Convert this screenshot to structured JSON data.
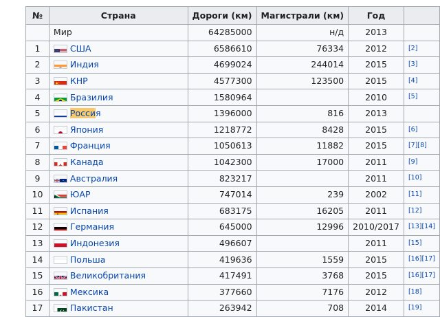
{
  "headers": {
    "rank": "№",
    "country": "Страна",
    "roads": "Дороги (км)",
    "highways": "Магистрали (км)",
    "year": "Год",
    "ref": ""
  },
  "world": {
    "name": "Мир",
    "roads": "64285000",
    "highways": "н/д",
    "year": "2013"
  },
  "rows": [
    {
      "rank": "1",
      "flag": "flag-usa-icon",
      "name": "США",
      "roads": "6586610",
      "highways": "76334",
      "year": "2012",
      "ref": "[2]"
    },
    {
      "rank": "2",
      "flag": "flag-india-icon",
      "name": "Индия",
      "roads": "4699024",
      "highways": "244014",
      "year": "2015",
      "ref": "[3]"
    },
    {
      "rank": "3",
      "flag": "flag-china-icon",
      "name": "КНР",
      "roads": "4577300",
      "highways": "123500",
      "year": "2015",
      "ref": "[4]"
    },
    {
      "rank": "4",
      "flag": "flag-brazil-icon",
      "name": "Бразилия",
      "roads": "1580964",
      "highways": "",
      "year": "2010",
      "ref": "[5]"
    },
    {
      "rank": "5",
      "flag": "flag-russia-icon",
      "name_hl": "Росси",
      "name_rest": "я",
      "roads": "1396000",
      "highways": "816",
      "year": "2013",
      "ref": ""
    },
    {
      "rank": "6",
      "flag": "flag-japan-icon",
      "name": "Япония",
      "roads": "1218772",
      "highways": "8428",
      "year": "2015",
      "ref": "[6]"
    },
    {
      "rank": "7",
      "flag": "flag-france-icon",
      "name": "Франция",
      "roads": "1050613",
      "highways": "11882",
      "year": "2015",
      "ref": "[7][8]"
    },
    {
      "rank": "8",
      "flag": "flag-canada-icon",
      "name": "Канада",
      "roads": "1042300",
      "highways": "17000",
      "year": "2011",
      "ref": "[9]"
    },
    {
      "rank": "9",
      "flag": "flag-australia-icon",
      "name": "Австралия",
      "roads": "823217",
      "highways": "",
      "year": "2011",
      "ref": "[10]"
    },
    {
      "rank": "10",
      "flag": "flag-sa-icon",
      "name": "ЮАР",
      "roads": "747014",
      "highways": "239",
      "year": "2002",
      "ref": "[11]"
    },
    {
      "rank": "11",
      "flag": "flag-spain-icon",
      "name": "Испания",
      "roads": "683175",
      "highways": "16205",
      "year": "2011",
      "ref": "[12]"
    },
    {
      "rank": "12",
      "flag": "flag-germany-icon",
      "name": "Германия",
      "roads": "645000",
      "highways": "12996",
      "year": "2010/2017",
      "ref": "[13][14]"
    },
    {
      "rank": "13",
      "flag": "flag-indonesia-icon",
      "name": "Индонезия",
      "roads": "496607",
      "highways": "",
      "year": "2011",
      "ref": "[15]"
    },
    {
      "rank": "14",
      "flag": "flag-poland-icon",
      "name": "Польша",
      "roads": "419636",
      "highways": "1559",
      "year": "2015",
      "ref": "[16][17]"
    },
    {
      "rank": "15",
      "flag": "flag-uk-icon",
      "name": "Великобритания",
      "roads": "417491",
      "highways": "3768",
      "year": "2015",
      "ref": "[16][17]"
    },
    {
      "rank": "16",
      "flag": "flag-mexico-icon",
      "name": "Мексика",
      "roads": "377660",
      "highways": "7176",
      "year": "2012",
      "ref": "[18]"
    },
    {
      "rank": "17",
      "flag": "flag-pakistan-icon",
      "name": "Пакистан",
      "roads": "263942",
      "highways": "708",
      "year": "2014",
      "ref": "[19]"
    }
  ]
}
